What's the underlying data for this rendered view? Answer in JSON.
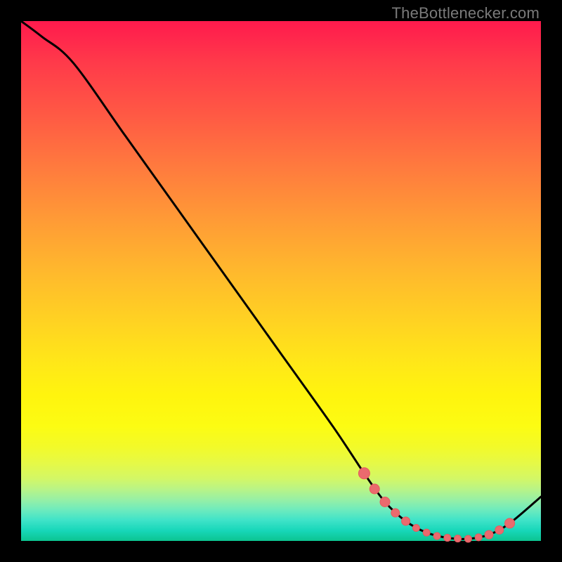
{
  "attribution": "TheBottlenecker.com",
  "colors": {
    "line": "#000000",
    "marker_fill": "#ea6a6e",
    "marker_stroke": "#e65a5e",
    "frame_bg": "#000000"
  },
  "chart_data": {
    "type": "line",
    "title": "",
    "xlabel": "",
    "ylabel": "",
    "xlim": [
      0,
      100
    ],
    "ylim": [
      0,
      100
    ],
    "series": [
      {
        "name": "curve",
        "x": [
          0,
          4,
          10,
          20,
          30,
          40,
          50,
          60,
          66,
          70,
          74,
          78,
          82,
          86,
          90,
          94,
          100
        ],
        "y": [
          100,
          97,
          92,
          78,
          64,
          50,
          36,
          22,
          13,
          7.5,
          3.8,
          1.6,
          0.6,
          0.4,
          1.2,
          3.4,
          8.5
        ]
      }
    ],
    "markers": {
      "name": "highlight-points",
      "x": [
        66,
        68,
        70,
        72,
        74,
        76,
        78,
        80,
        82,
        84,
        86,
        88,
        90,
        92,
        94
      ],
      "y": [
        13,
        10,
        7.5,
        5.4,
        3.8,
        2.5,
        1.6,
        0.95,
        0.6,
        0.45,
        0.4,
        0.7,
        1.2,
        2.1,
        3.4
      ],
      "r": [
        8,
        7,
        7,
        6,
        6,
        5,
        5,
        5,
        5,
        5,
        5,
        5,
        6,
        6,
        7
      ]
    }
  }
}
